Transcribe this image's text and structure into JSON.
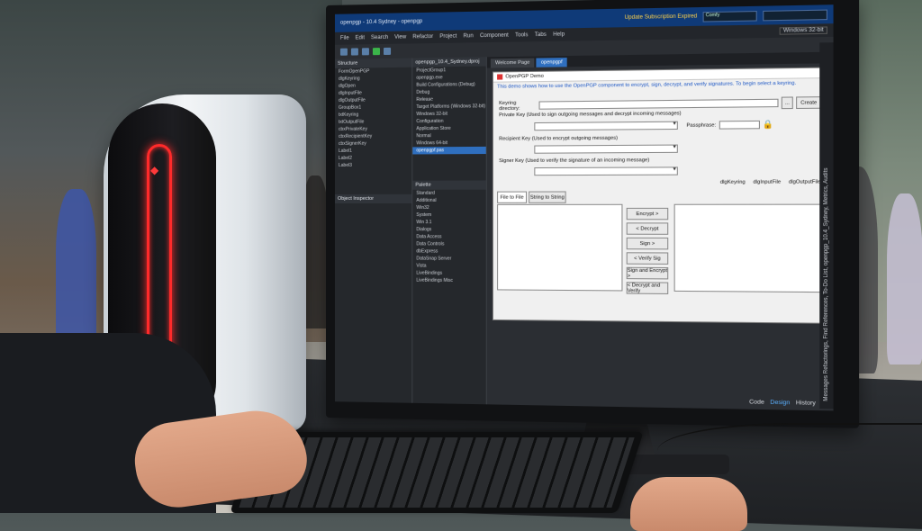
{
  "ide": {
    "window_title": "openpgp - 10.4 Sydney - openpgp",
    "subscription_notice": "Update Subscription Expired",
    "layout_field": "Comfy",
    "platform_combo": "Windows 32-bit",
    "menu": [
      "File",
      "Edit",
      "Search",
      "View",
      "Refactor",
      "Project",
      "Run",
      "Component",
      "Tools",
      "Tabs",
      "Help"
    ],
    "panels": {
      "structure_title": "Structure",
      "projects_title": "openpgp_10.4_Sydney.dproj",
      "object_inspector_title": "Object Inspector",
      "palette_title": "Palette"
    },
    "structure_items": [
      "FormOpenPGP",
      "dlgKeyring",
      "dlgOpen",
      "dlgInputFile",
      "dlgOutputFile",
      "GroupBox1",
      "txtKeyring",
      "txtOutputFile",
      "cbxPrivateKey",
      "cbxRecipientKey",
      "cbxSignerKey",
      "Label1",
      "Label2",
      "Label3"
    ],
    "project_items": [
      "ProjectGroup1",
      "openpgp.exe",
      "Build Configurations (Debug)",
      "Debug",
      "Release",
      "Target Platforms (Windows 32-bit)",
      "Windows 32-bit",
      "Configuration",
      "Application Store",
      "Normal",
      "Windows 64-bit",
      "openpgpf.pas"
    ],
    "palette_items": [
      "Standard",
      "Additional",
      "Win32",
      "System",
      "Win 3.1",
      "Dialogs",
      "Data Access",
      "Data Controls",
      "dbExpress",
      "DataSnap Server",
      "Vista",
      "LiveBindings",
      "LiveBindings Misc"
    ],
    "doc_tabs": [
      "Welcome Page",
      "openpgpf"
    ],
    "bottom_tabs": [
      "Code",
      "Design",
      "History"
    ],
    "side_tabs": "Messages  Refactorings, Find References, To-Do List, openpgp_10.4_Sydney, Metrics, Audits"
  },
  "form": {
    "title": "OpenPGP Demo",
    "description": "This demo shows how to use the OpenPGP component to encrypt, sign, decrypt, and verify signatures. To begin select a keyring.",
    "keyring_label": "Keyring directory:",
    "browse_button": "...",
    "create_button": "Create",
    "private_key_label": "Private Key (Used to sign outgoing messages and decrypt incoming messages)",
    "passphrase_label": "Passphrase:",
    "recipient_label": "Recipient Key (Used to encrypt outgoing messages)",
    "signer_label": "Signer Key (Used to verify the signature of an incoming message)",
    "tab_file_to_file": "File to File",
    "tab_string_to_string": "String to String",
    "buttons": [
      "Encrypt >",
      "< Decrypt",
      "Sign >",
      "< Verify Sig",
      "Sign and Encrypt >",
      "< Decrypt and Verify"
    ],
    "dialogs": [
      "dlgKeyring",
      "dlgInputFile",
      "dlgOutputFile"
    ]
  }
}
